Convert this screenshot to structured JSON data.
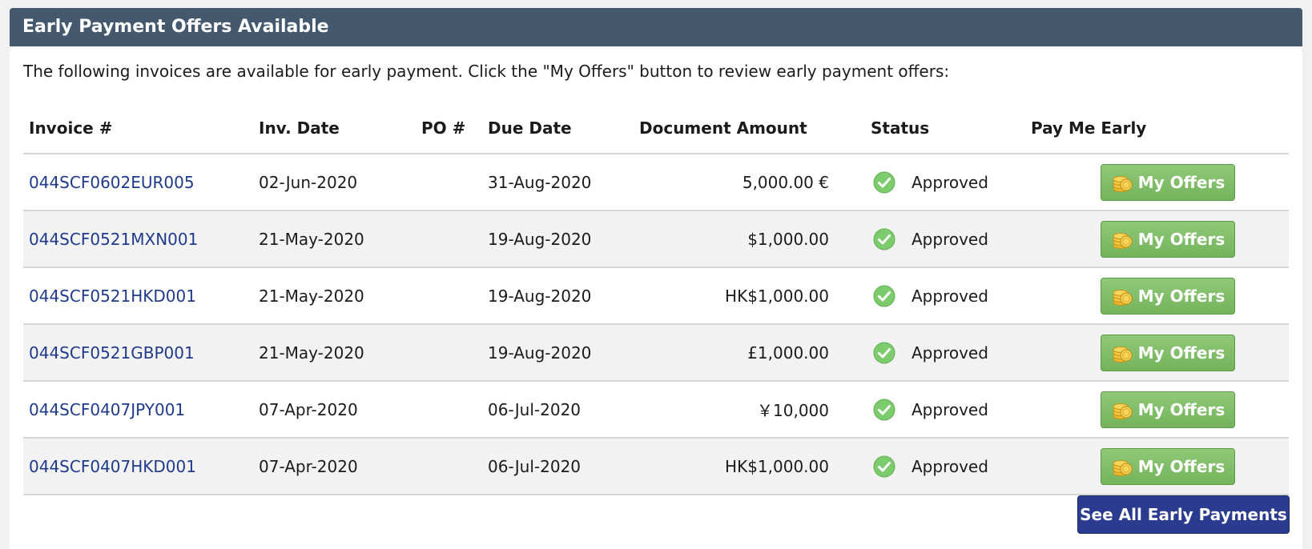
{
  "panel": {
    "title": "Early Payment Offers Available",
    "intro": "The following invoices are available for early payment. Click the \"My Offers\" button to review early payment offers:"
  },
  "table": {
    "headers": {
      "invoice": "Invoice #",
      "inv_date": "Inv. Date",
      "po": "PO #",
      "due_date": "Due Date",
      "amount": "Document Amount",
      "status": "Status",
      "pay_early": "Pay Me Early"
    },
    "rows": [
      {
        "invoice": "044SCF0602EUR005",
        "inv_date": "02-Jun-2020",
        "po": "",
        "due_date": "31-Aug-2020",
        "amount": "5,000.00 €",
        "status": "Approved",
        "action": "My Offers"
      },
      {
        "invoice": "044SCF0521MXN001",
        "inv_date": "21-May-2020",
        "po": "",
        "due_date": "19-Aug-2020",
        "amount": "$1,000.00",
        "status": "Approved",
        "action": "My Offers"
      },
      {
        "invoice": "044SCF0521HKD001",
        "inv_date": "21-May-2020",
        "po": "",
        "due_date": "19-Aug-2020",
        "amount": "HK$1,000.00",
        "status": "Approved",
        "action": "My Offers"
      },
      {
        "invoice": "044SCF0521GBP001",
        "inv_date": "21-May-2020",
        "po": "",
        "due_date": "19-Aug-2020",
        "amount": "£1,000.00",
        "status": "Approved",
        "action": "My Offers"
      },
      {
        "invoice": "044SCF0407JPY001",
        "inv_date": "07-Apr-2020",
        "po": "",
        "due_date": "06-Jul-2020",
        "amount": "￥10,000",
        "status": "Approved",
        "action": "My Offers"
      },
      {
        "invoice": "044SCF0407HKD001",
        "inv_date": "07-Apr-2020",
        "po": "",
        "due_date": "06-Jul-2020",
        "amount": "HK$1,000.00",
        "status": "Approved",
        "action": "My Offers"
      }
    ]
  },
  "footer": {
    "see_all_label": "See All Early Payments"
  },
  "icons": {
    "status": "check-circle-icon",
    "offers": "coins-icon"
  },
  "colors": {
    "header_bg": "#44596d",
    "link": "#1f3a8a",
    "offers_button": "#7fbc66",
    "see_all_button": "#2b3b8f",
    "approved_check": "#7ccb6c"
  }
}
